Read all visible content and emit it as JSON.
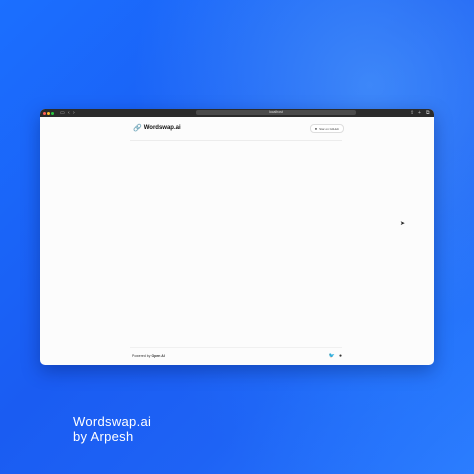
{
  "browser": {
    "url": "localhost",
    "nav_back_icon": "chevron-left-icon",
    "nav_forward_icon": "chevron-right-icon"
  },
  "app": {
    "logo_text": "Wordswap.ai",
    "star_button_label": "Star on GitHub"
  },
  "footer": {
    "powered_prefix": "Powered by",
    "powered_brand": "Open AI"
  },
  "caption": {
    "line1": "Wordswap.ai",
    "line2": "by Arpesh"
  },
  "colors": {
    "background": "#1a5cf2",
    "window_bg": "#fcfcfc",
    "titlebar": "#2b2b2b"
  }
}
